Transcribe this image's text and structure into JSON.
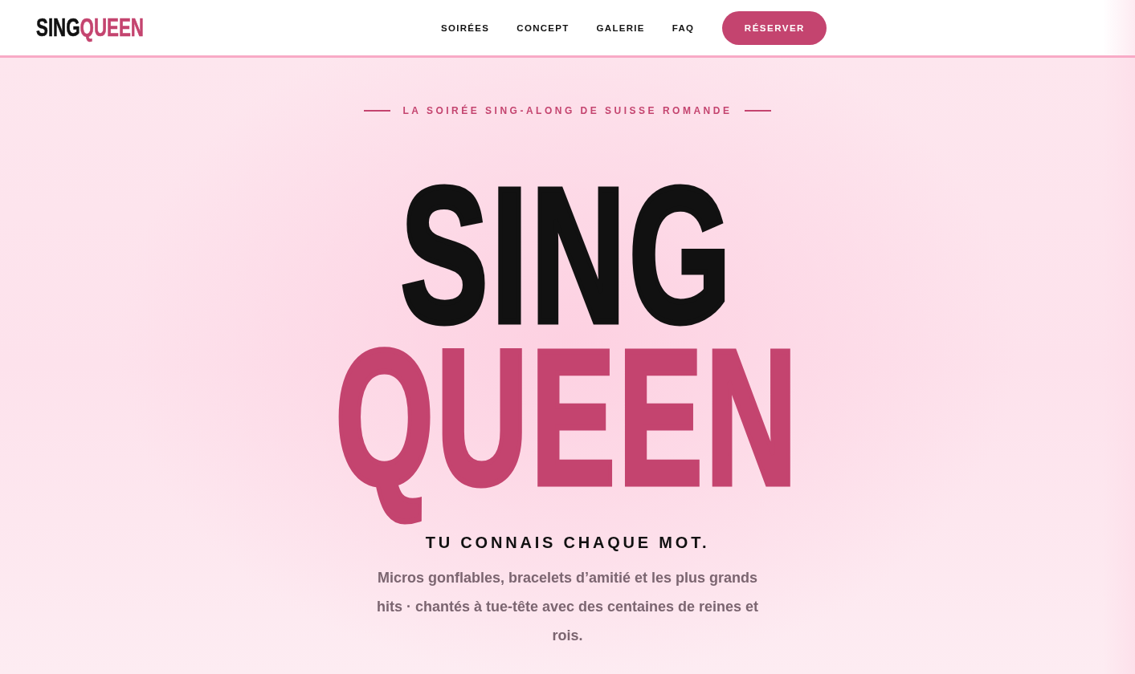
{
  "header": {
    "logo": {
      "part_1": "SING",
      "part_2": "QUEEN"
    },
    "nav": [
      "SOIRÉES",
      "CONCEPT",
      "GALERIE",
      "FAQ"
    ],
    "cta": "RÉSERVER"
  },
  "hero": {
    "eyebrow": "LA SOIRÉE SING-ALONG DE SUISSE ROMANDE",
    "title": [
      "SING",
      "QUEEN"
    ],
    "tagline": "TU CONNAIS CHAQUE MOT.",
    "description": "Micros gonflables, bracelets d’amitié et les plus grands hits · chantés à tue-tête avec des centaines de reines et rois."
  }
}
